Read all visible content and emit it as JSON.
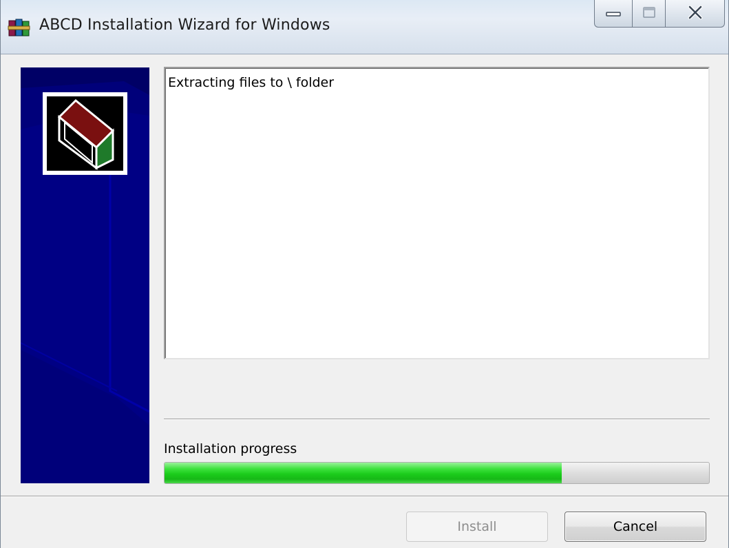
{
  "window": {
    "title": "ABCD Installation Wizard for Windows",
    "icon": "winrar-books-icon"
  },
  "caption_buttons": {
    "minimize_icon": "minimize-icon",
    "maximize_icon": "maximize-icon",
    "close_icon": "close-icon"
  },
  "side_panel": {
    "background_color": "#000066",
    "logo_icon": "archive-box-icon"
  },
  "log": {
    "lines": [
      "Extracting files to \\ folder"
    ]
  },
  "progress": {
    "label": "Installation progress",
    "value": 0.73,
    "fill_color": "#22cc22"
  },
  "buttons": {
    "install_label": "Install",
    "install_enabled": false,
    "cancel_label": "Cancel"
  }
}
